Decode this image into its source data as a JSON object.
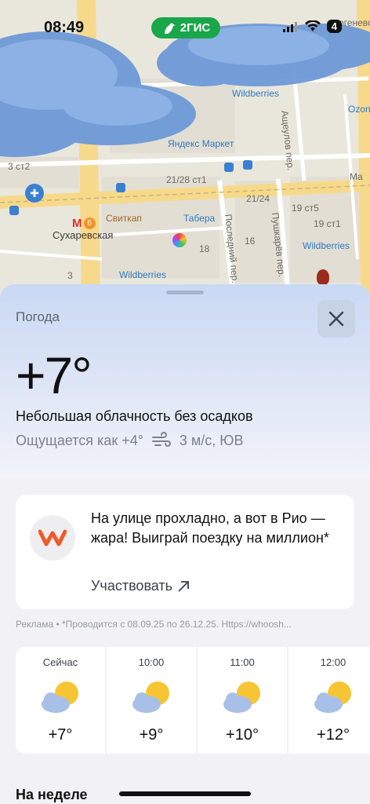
{
  "status_bar": {
    "time": "08:49",
    "app_badge": "2ГИС",
    "battery": "4"
  },
  "map": {
    "labels": {
      "sukharevskaya": "Сухаревская",
      "svitkap": "Свиткап",
      "tabera": "Табера",
      "wildberries_1": "Wildberries",
      "wildberries_2": "Wildberries",
      "wildberries_3": "Wildberries",
      "yandex_market": "Яндекс Маркет",
      "ozon": "Ozon",
      "ashcheulov": "Ащеулов пер.",
      "posledniy": "Последний пер.",
      "pushkarev": "Пушкарёв пер.",
      "metro_line": "6",
      "n_21_28": "21/28 ст1",
      "n_21_24": "21/24",
      "n_19_5": "19 ст5",
      "n_19_1": "19 ст1",
      "n_3_2": "3 ст2",
      "n_18": "18",
      "n_16": "16",
      "n_3": "3",
      "turgenevskaya_partial": "ргеневско",
      "wildberries_top": "Wildberries",
      "ma_partial": "Ma"
    }
  },
  "weather": {
    "title": "Погода",
    "temperature": "+7°",
    "condition": "Небольшая облачность без осадков",
    "feels_like": "Ощущается как +4°",
    "wind": "3 м/с, ЮВ"
  },
  "ad": {
    "text": "На улице прохладно, а вот в Рио — жара! Выиграй поездку на миллион*",
    "link": "Участвовать",
    "disclaimer": "Реклама • *Проводится с 08.09.25 по 26.12.25. Https://whoosh..."
  },
  "hourly": [
    {
      "time": "Сейчас",
      "temp": "+7°",
      "icon": "partly-cloudy-icon"
    },
    {
      "time": "10:00",
      "temp": "+9°",
      "icon": "partly-cloudy-icon"
    },
    {
      "time": "11:00",
      "temp": "+10°",
      "icon": "partly-cloudy-icon"
    },
    {
      "time": "12:00",
      "temp": "+12°",
      "icon": "partly-cloudy-icon"
    }
  ],
  "week_title": "На неделе",
  "colors": {
    "accent_green": "#1aa64a",
    "ad_logo": "#f05a28",
    "sun": "#f7c533",
    "cloud": "#a8c0e8"
  }
}
